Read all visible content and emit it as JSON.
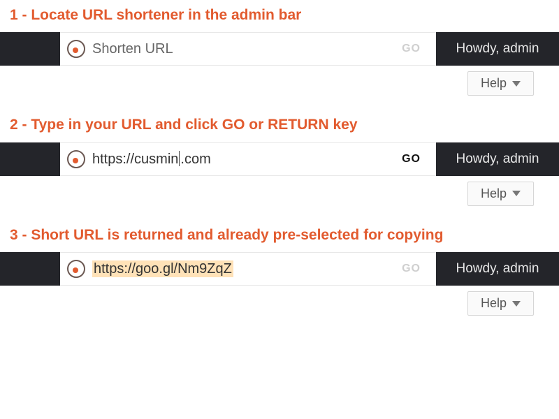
{
  "colors": {
    "accent": "#e25b2f",
    "bar_dark": "#24252a"
  },
  "howdy": "Howdy, admin",
  "help_label": "Help",
  "go_label": "GO",
  "icon_name": "cusmin-logo-icon",
  "steps": [
    {
      "number": "1",
      "caption": "1 - Locate URL shortener in the admin bar",
      "placeholder": "Shorten URL",
      "value": "",
      "go_active": false,
      "selected": false,
      "show_caret": false
    },
    {
      "number": "2",
      "caption": "2 - Type in your URL and click GO or RETURN key",
      "value_prefix": "https://cusmin",
      "value_suffix": ".com",
      "go_active": true,
      "selected": false,
      "show_caret": true
    },
    {
      "number": "3",
      "caption": "3 - Short URL is returned and already pre-selected for copying",
      "value": "https://goo.gl/Nm9ZqZ",
      "go_active": false,
      "selected": true,
      "show_caret": false
    }
  ]
}
